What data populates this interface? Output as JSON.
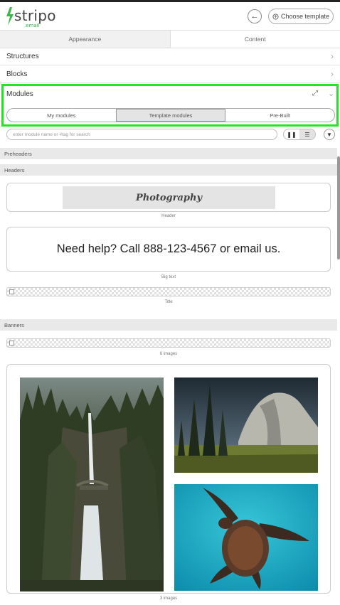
{
  "header": {
    "logo_word": "stripo",
    "logo_sub": ".email",
    "back_icon": "arrow-left-icon",
    "choose_template_label": "Choose template"
  },
  "tabs": [
    {
      "label": "Appearance"
    },
    {
      "label": "Content"
    }
  ],
  "sections": {
    "structures": "Structures",
    "blocks": "Blocks",
    "modules": "Modules"
  },
  "modules_tabs": {
    "my": "My modules",
    "template": "Template modules",
    "prebuilt": "Pre-Built",
    "active": "Template modules"
  },
  "search": {
    "placeholder": "enter module name or #tag for search"
  },
  "categories": {
    "preheaders": "Preheaders",
    "headers": "Headers",
    "banners": "Banners"
  },
  "items": {
    "header_photo_text": "Photography",
    "header_caption": "Header",
    "bigtext_text": "Need help? Call 888-123-4567 or email us.",
    "bigtext_caption": "Big text",
    "title_caption": "Title",
    "six_images_caption": "6 images",
    "three_images_caption": "3 images"
  },
  "colors": {
    "accent": "#3cb54a",
    "highlight": "#22e61f"
  }
}
